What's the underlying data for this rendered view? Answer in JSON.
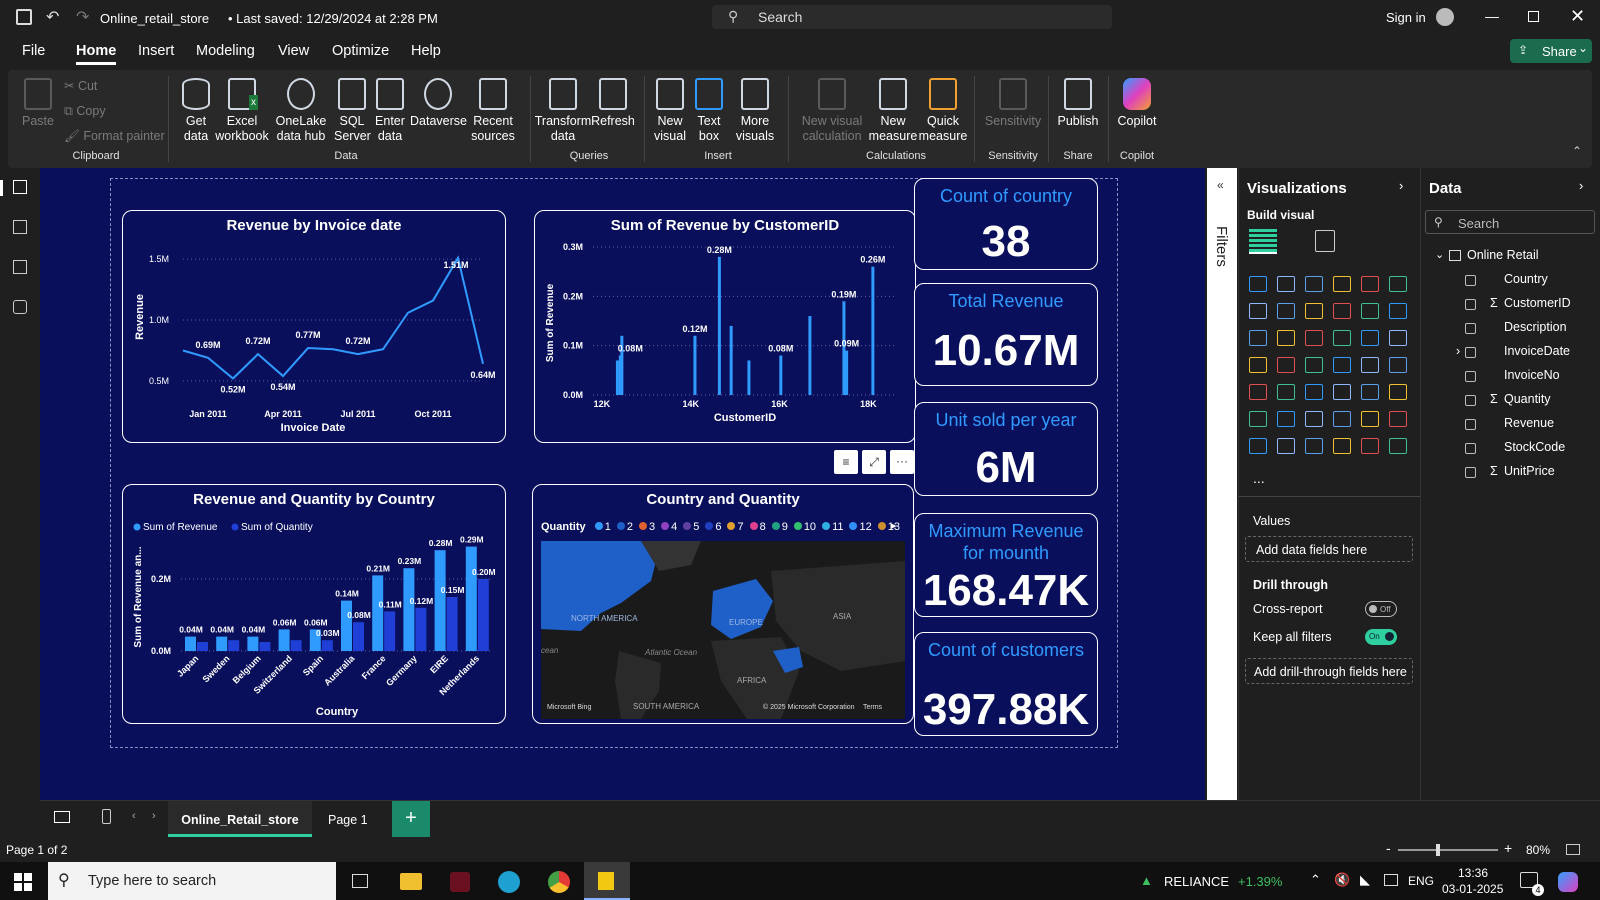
{
  "titlebar": {
    "file_name": "Online_retail_store",
    "saved": "• Last saved: 12/29/2024 at 2:28 PM",
    "search_placeholder": "Search",
    "sign_in": "Sign in",
    "share": "Share"
  },
  "menu": [
    "File",
    "Home",
    "Insert",
    "Modeling",
    "View",
    "Optimize",
    "Help"
  ],
  "ribbon": {
    "clipboard": {
      "paste": "Paste",
      "cut": "Cut",
      "copy": "Copy",
      "format_painter": "Format painter",
      "group": "Clipboard"
    },
    "data": {
      "get_data": "Get data",
      "excel": "Excel workbook",
      "onelake": "OneLake data hub",
      "sql": "SQL Server",
      "enter": "Enter data",
      "dataverse": "Dataverse",
      "recent": "Recent sources",
      "group": "Data"
    },
    "queries": {
      "transform": "Transform data",
      "refresh": "Refresh",
      "group": "Queries"
    },
    "insert": {
      "new_visual": "New visual",
      "text_box": "Text box",
      "more_visuals": "More visuals",
      "group": "Insert"
    },
    "calculations": {
      "new_visual_calc": "New visual calculation",
      "new_measure": "New measure",
      "quick_measure": "Quick measure",
      "group": "Calculations"
    },
    "sensitivity": {
      "label": "Sensitivity",
      "group": "Sensitivity"
    },
    "share": {
      "publish": "Publish",
      "group": "Share"
    },
    "copilot": {
      "label": "Copilot",
      "group": "Copilot"
    }
  },
  "kpis": [
    {
      "label": "Count of country",
      "value": "38"
    },
    {
      "label": "Total Revenue",
      "value": "10.67M"
    },
    {
      "label": "Unit sold per year",
      "value": "6M"
    },
    {
      "label": "Maximum Revenue for mounth",
      "value": "168.47K"
    },
    {
      "label": "Count of customers",
      "value": "397.88K"
    }
  ],
  "chart_titles": {
    "revenue_by_date": "Revenue by Invoice date",
    "revenue_by_customer": "Sum of Revenue by CustomerID",
    "rev_qty_country": "Revenue and Quantity by Country",
    "map": "Country and Quantity"
  },
  "chart_data": [
    {
      "type": "line",
      "title": "Revenue by Invoice date",
      "xlabel": "Invoice Date",
      "ylabel": "Revenue",
      "x": [
        "2010-12",
        "2011-01",
        "2011-02",
        "2011-03",
        "2011-04",
        "2011-05",
        "2011-06",
        "2011-07",
        "2011-08",
        "2011-09",
        "2011-10",
        "2011-11",
        "2011-12"
      ],
      "values": [
        0.75,
        0.69,
        0.52,
        0.72,
        0.54,
        0.77,
        0.76,
        0.72,
        0.76,
        1.06,
        1.16,
        1.51,
        0.64
      ],
      "data_labels": [
        "0.69M",
        "0.52M",
        "0.72M",
        "0.54M",
        "0.77M",
        "0.72M",
        "1.51M",
        "0.64M"
      ],
      "xticks": [
        "Jan 2011",
        "Apr 2011",
        "Jul 2011",
        "Oct 2011"
      ],
      "yticks": [
        "0.5M",
        "1.0M",
        "1.5M"
      ],
      "ylim": [
        0.45,
        1.6
      ]
    },
    {
      "type": "bar",
      "title": "Sum of Revenue by CustomerID",
      "xlabel": "CustomerID",
      "ylabel": "Sum of Revenue",
      "x": [
        12350,
        12415,
        12450,
        14096,
        14646,
        14911,
        15311,
        16029,
        16684,
        17450,
        17511,
        18102
      ],
      "values": [
        0.07,
        0.08,
        0.12,
        0.12,
        0.28,
        0.14,
        0.07,
        0.08,
        0.16,
        0.19,
        0.09,
        0.26
      ],
      "data_labels": [
        "0.08M",
        "0.12M",
        "0.28M",
        "0.08M",
        "0.19M",
        "0.09M",
        "0.26M"
      ],
      "xticks": [
        "12K",
        "14K",
        "16K",
        "18K"
      ],
      "yticks": [
        "0.0M",
        "0.1M",
        "0.2M",
        "0.3M"
      ],
      "ylim": [
        0,
        0.3
      ]
    },
    {
      "type": "bar",
      "title": "Revenue and Quantity by Country",
      "xlabel": "Country",
      "ylabel": "Sum of Revenue an...",
      "categories": [
        "Japan",
        "Sweden",
        "Belgium",
        "Switzerland",
        "Spain",
        "Australia",
        "France",
        "Germany",
        "EIRE",
        "Netherlands"
      ],
      "series": [
        {
          "name": "Sum of Revenue",
          "values": [
            0.04,
            0.04,
            0.04,
            0.06,
            0.06,
            0.14,
            0.21,
            0.23,
            0.28,
            0.29
          ],
          "labels": [
            "0.04M",
            "0.04M",
            "0.04M",
            "0.06M",
            "0.06M",
            "0.14M",
            "0.21M",
            "0.23M",
            "0.28M",
            "0.29M"
          ]
        },
        {
          "name": "Sum of Quantity",
          "values": [
            0.025,
            0.03,
            0.025,
            0.03,
            0.03,
            0.08,
            0.11,
            0.12,
            0.15,
            0.2
          ],
          "labels": [
            "",
            "",
            "",
            "",
            "0.03M",
            "0.08M",
            "0.11M",
            "0.12M",
            "0.15M",
            "0.20M"
          ]
        }
      ],
      "yticks": [
        "0.0M",
        "0.2M"
      ],
      "ylim": [
        0,
        0.3
      ]
    }
  ],
  "map": {
    "legend_title": "Quantity",
    "legend": [
      "1",
      "2",
      "3",
      "4",
      "5",
      "6",
      "7",
      "8",
      "9",
      "10",
      "11",
      "12",
      "13"
    ],
    "labels": {
      "na": "NORTH AMERICA",
      "eu": "EUROPE",
      "asia": "ASIA",
      "africa": "AFRICA",
      "sa": "SOUTH AMERICA",
      "atl": "Atlantic Ocean",
      "ocean": "cean"
    },
    "credit": "© 2025 Microsoft Corporation",
    "terms": "Terms",
    "bing": "Microsoft Bing"
  },
  "filters": "Filters",
  "viz": {
    "title": "Visualizations",
    "build": "Build visual",
    "values": "Values",
    "add_fields": "Add data fields here",
    "drill": "Drill through",
    "cross": "Cross-report",
    "keep": "Keep all filters",
    "off": "Off",
    "on": "On",
    "add_drill": "Add drill-through fields here",
    "more": "..."
  },
  "datapane": {
    "title": "Data",
    "search": "Search",
    "table": "Online Retail",
    "fields": [
      "Country",
      "CustomerID",
      "Description",
      "InvoiceDate",
      "InvoiceNo",
      "Quantity",
      "Revenue",
      "StockCode",
      "UnitPrice"
    ]
  },
  "tabs": {
    "active": "Online_Retail_store",
    "page1": "Page 1",
    "add": "+"
  },
  "status": {
    "page": "Page 1 of 2",
    "zoom": "80%"
  },
  "taskbar": {
    "search": "Type here to search",
    "stock": "RELIANCE",
    "change": "+1.39%",
    "lang": "ENG",
    "time": "13:36",
    "date": "03-01-2025",
    "notif": "4"
  },
  "colors": {
    "canvas": "#0a0f5c",
    "accent": "#2f9bff",
    "series2": "#1f3fd6",
    "share": "#1b6b4e"
  }
}
